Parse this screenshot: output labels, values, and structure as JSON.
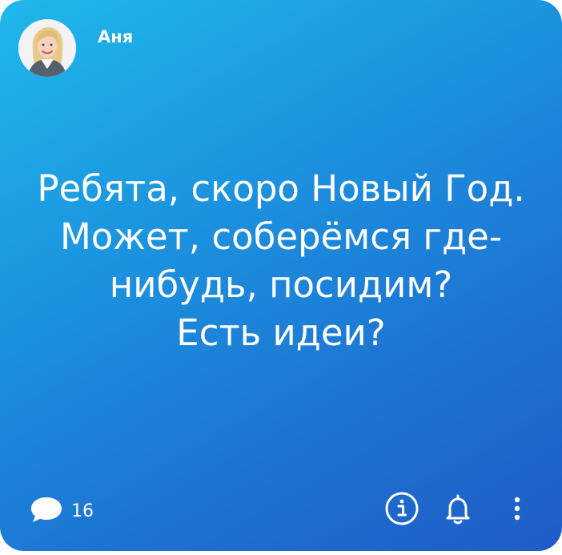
{
  "post": {
    "author": {
      "name": "Аня",
      "avatar_icon": "user-avatar-photo"
    },
    "message": "Ребята, скоро Новый Год.\nМожет, соберёмся где-\nнибудь, посидим?\nЕсть идеи?",
    "comments": {
      "icon": "speech-bubble-icon",
      "count": "16"
    },
    "actions": {
      "info_icon": "info-icon",
      "bell_icon": "bell-icon",
      "more_icon": "more-vertical-icon"
    }
  },
  "colors": {
    "gradient_start": "#1fb8ea",
    "gradient_end": "#1f5cc6",
    "text": "#ffffff"
  }
}
